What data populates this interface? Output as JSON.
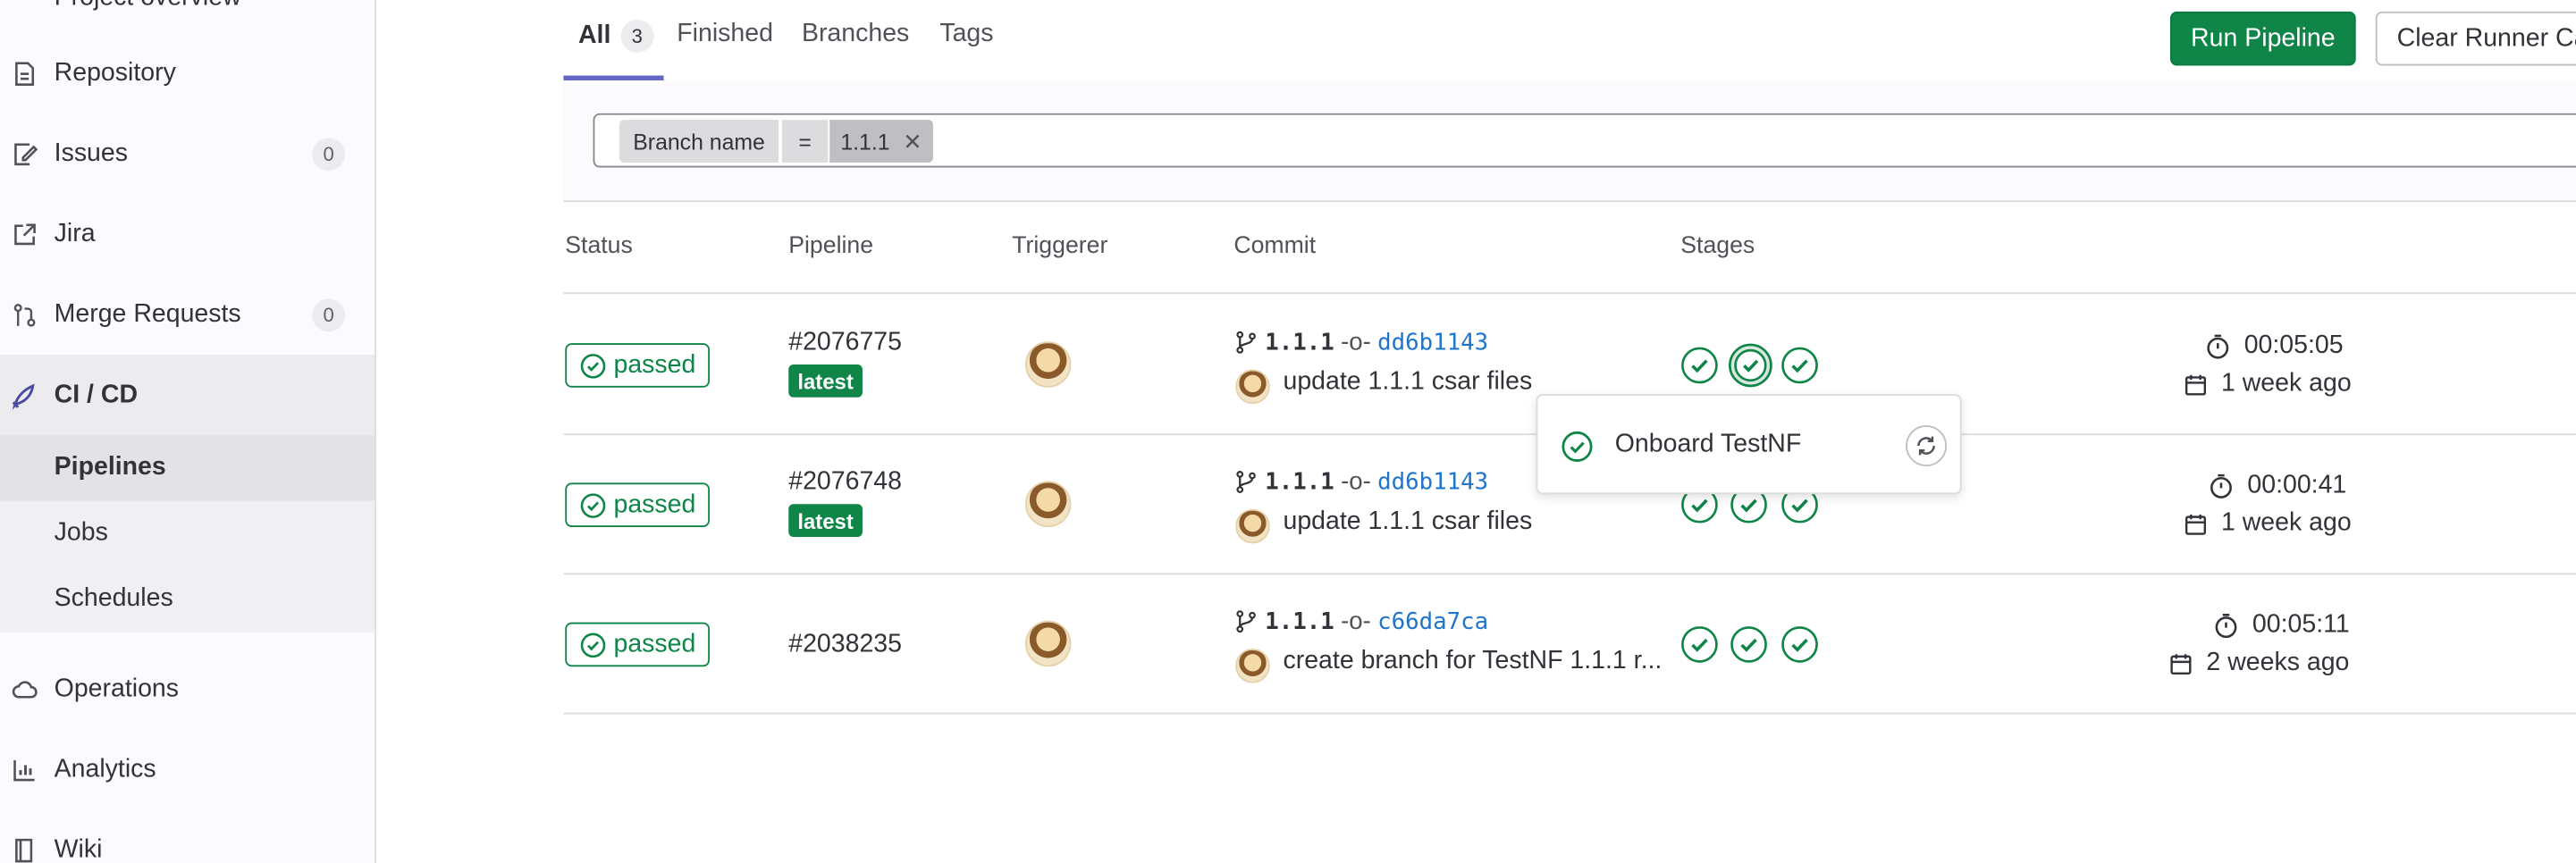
{
  "sidebar": {
    "top_partial_label": "Project overview",
    "items": [
      {
        "label": "Repository",
        "icon": "document-icon"
      },
      {
        "label": "Issues",
        "icon": "issues-icon",
        "count": "0"
      },
      {
        "label": "Jira",
        "icon": "external-link-icon"
      },
      {
        "label": "Merge Requests",
        "icon": "merge-request-icon",
        "count": "0"
      },
      {
        "label": "CI / CD",
        "icon": "rocket-icon"
      },
      {
        "label": "Operations",
        "icon": "cloud-icon"
      },
      {
        "label": "Analytics",
        "icon": "chart-icon"
      },
      {
        "label": "Wiki",
        "icon": "book-icon"
      }
    ],
    "cicd_sub": [
      {
        "label": "Pipelines"
      },
      {
        "label": "Jobs"
      },
      {
        "label": "Schedules"
      }
    ]
  },
  "tabs": [
    {
      "label": "All",
      "count": "3"
    },
    {
      "label": "Finished"
    },
    {
      "label": "Branches"
    },
    {
      "label": "Tags"
    }
  ],
  "actions": {
    "run_pipeline": "Run Pipeline",
    "clear_runner_caches": "Clear Runner Caches"
  },
  "filter": {
    "token_key": "Branch name",
    "token_op": "=",
    "token_value": "1.1.1"
  },
  "table": {
    "headers": {
      "status": "Status",
      "pipeline": "Pipeline",
      "triggerer": "Triggerer",
      "commit": "Commit",
      "stages": "Stages"
    },
    "rows": [
      {
        "status": "passed",
        "pipeline_id": "#2076775",
        "badge": "latest",
        "branch": "1.1.1",
        "sha": "dd6b1143",
        "commit_title": "update 1.1.1 csar files",
        "stages": [
          "success",
          "success",
          "success"
        ],
        "duration": "00:05:05",
        "finished": "1 week ago"
      },
      {
        "status": "passed",
        "pipeline_id": "#2076748",
        "badge": "latest",
        "branch": "1.1.1",
        "sha": "dd6b1143",
        "commit_title": "update 1.1.1 csar files",
        "stages": [
          "success",
          "success",
          "success"
        ],
        "duration": "00:00:41",
        "finished": "1 week ago"
      },
      {
        "status": "passed",
        "pipeline_id": "#2038235",
        "badge": "",
        "branch": "1.1.1",
        "sha": "c66da7ca",
        "commit_title": "create branch for TestNF 1.1.1 r...",
        "stages": [
          "success",
          "success",
          "success"
        ],
        "duration": "00:05:11",
        "finished": "2 weeks ago"
      }
    ]
  },
  "popover": {
    "job_name": "Onboard TestNF",
    "job_status": "success"
  },
  "colors": {
    "success": "#108548",
    "link": "#1f75cb",
    "accent": "#6666c4"
  }
}
